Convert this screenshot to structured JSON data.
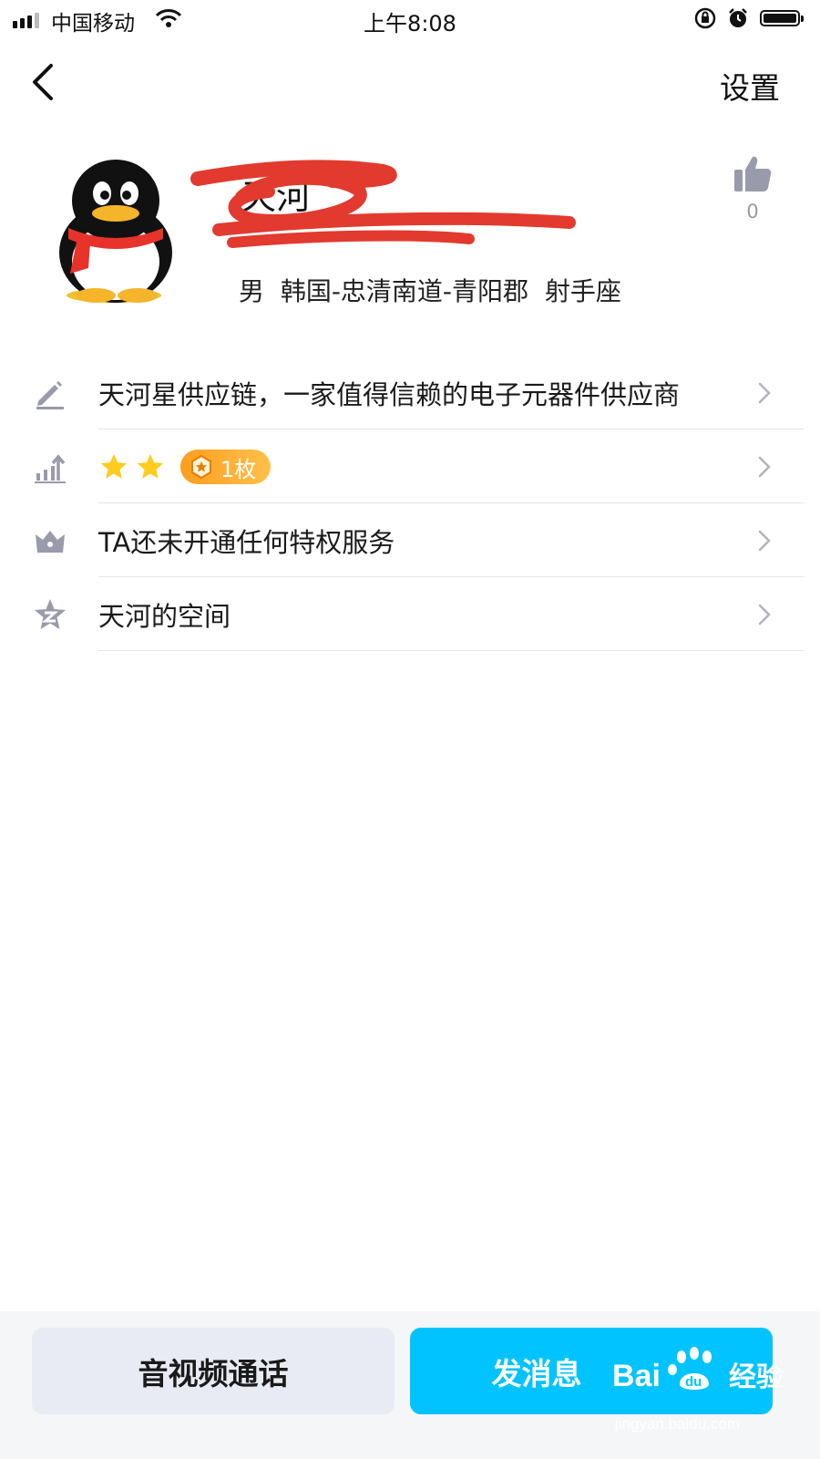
{
  "status_bar": {
    "carrier": "中国移动",
    "time": "上午8:08"
  },
  "nav": {
    "settings_label": "设置"
  },
  "profile": {
    "name": "天河",
    "gender": "男",
    "location": "韩国-忠清南道-青阳郡",
    "zodiac": "射手座",
    "like_count": "0"
  },
  "rows": [
    {
      "icon": "pencil-icon",
      "label": "天河星供应链，一家值得信赖的电子元器件供应商"
    },
    {
      "icon": "level-up-icon",
      "stars": 2,
      "badge_label": "1枚"
    },
    {
      "icon": "crown-icon",
      "label": "TA还未开通任何特权服务"
    },
    {
      "icon": "qzone-star-icon",
      "label": "天河的空间"
    }
  ],
  "buttons": {
    "call_label": "音视频通话",
    "message_label": "发消息"
  },
  "watermark": {
    "text": "jingyan.baidu.com",
    "label": "经验"
  },
  "colors": {
    "accent": "#00c3ff",
    "badge": "#ffab2e",
    "star": "#ffcc1f",
    "icon_gray": "#9a9aad"
  }
}
